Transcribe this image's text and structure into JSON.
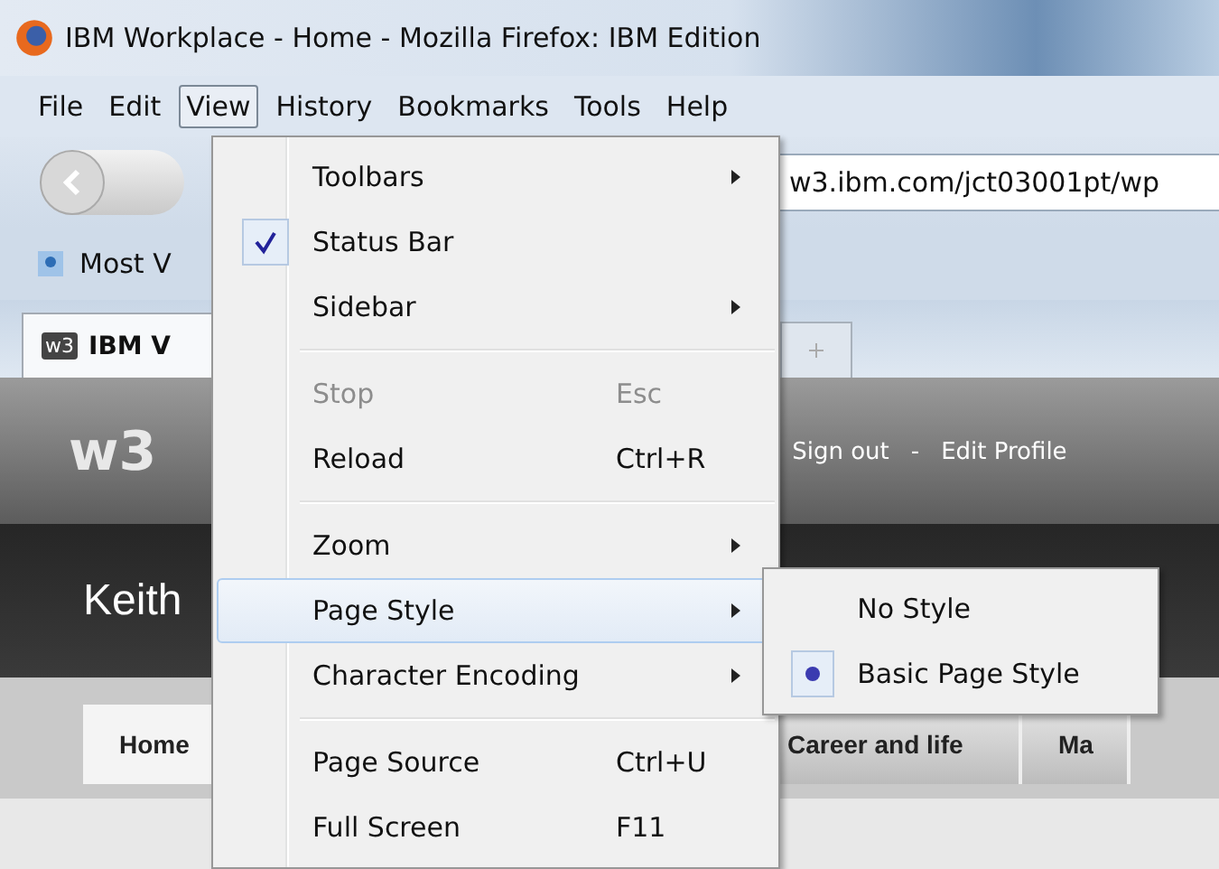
{
  "window": {
    "title": "IBM Workplace - Home - Mozilla Firefox: IBM Edition"
  },
  "menubar": [
    {
      "label": "File",
      "selected": false
    },
    {
      "label": "Edit",
      "selected": false
    },
    {
      "label": "View",
      "selected": true
    },
    {
      "label": "History",
      "selected": false
    },
    {
      "label": "Bookmarks",
      "selected": false
    },
    {
      "label": "Tools",
      "selected": false
    },
    {
      "label": "Help",
      "selected": false
    }
  ],
  "address_bar": {
    "value": "w3.ibm.com/jct03001pt/wp"
  },
  "bookmarks_bar": [
    {
      "label": "Most V"
    }
  ],
  "browser_tabs": [
    {
      "label": "IBM V",
      "favicon": "w3",
      "selected": true
    }
  ],
  "site_header": {
    "logo": "w3",
    "links": [
      "Sign out",
      "-",
      "Edit Profile"
    ]
  },
  "banner": {
    "name": "Keith"
  },
  "site_tabs": [
    {
      "label": "Home",
      "selected": true
    },
    {
      "label": "Career and life",
      "selected": false
    },
    {
      "label": "Ma",
      "selected": false
    }
  ],
  "view_menu": {
    "groups": [
      [
        {
          "label": "Toolbars",
          "submenu": true,
          "checked": false,
          "disabled": false,
          "selected": false
        },
        {
          "label": "Status Bar",
          "submenu": false,
          "checked": true,
          "disabled": false,
          "selected": false
        },
        {
          "label": "Sidebar",
          "submenu": true,
          "checked": false,
          "disabled": false,
          "selected": false
        }
      ],
      [
        {
          "label": "Stop",
          "shortcut": "Esc",
          "submenu": false,
          "checked": false,
          "disabled": true,
          "selected": false
        },
        {
          "label": "Reload",
          "shortcut": "Ctrl+R",
          "submenu": false,
          "checked": false,
          "disabled": false,
          "selected": false
        }
      ],
      [
        {
          "label": "Zoom",
          "submenu": true,
          "checked": false,
          "disabled": false,
          "selected": false
        },
        {
          "label": "Page Style",
          "submenu": true,
          "checked": false,
          "disabled": false,
          "selected": true
        },
        {
          "label": "Character Encoding",
          "submenu": true,
          "checked": false,
          "disabled": false,
          "selected": false
        }
      ],
      [
        {
          "label": "Page Source",
          "shortcut": "Ctrl+U",
          "submenu": false,
          "checked": false,
          "disabled": false,
          "selected": false
        },
        {
          "label": "Full Screen",
          "shortcut": "F11",
          "submenu": false,
          "checked": false,
          "disabled": false,
          "selected": false
        }
      ]
    ]
  },
  "page_style_menu": [
    {
      "label": "No Style",
      "selected": false
    },
    {
      "label": "Basic Page Style",
      "selected": true
    }
  ]
}
